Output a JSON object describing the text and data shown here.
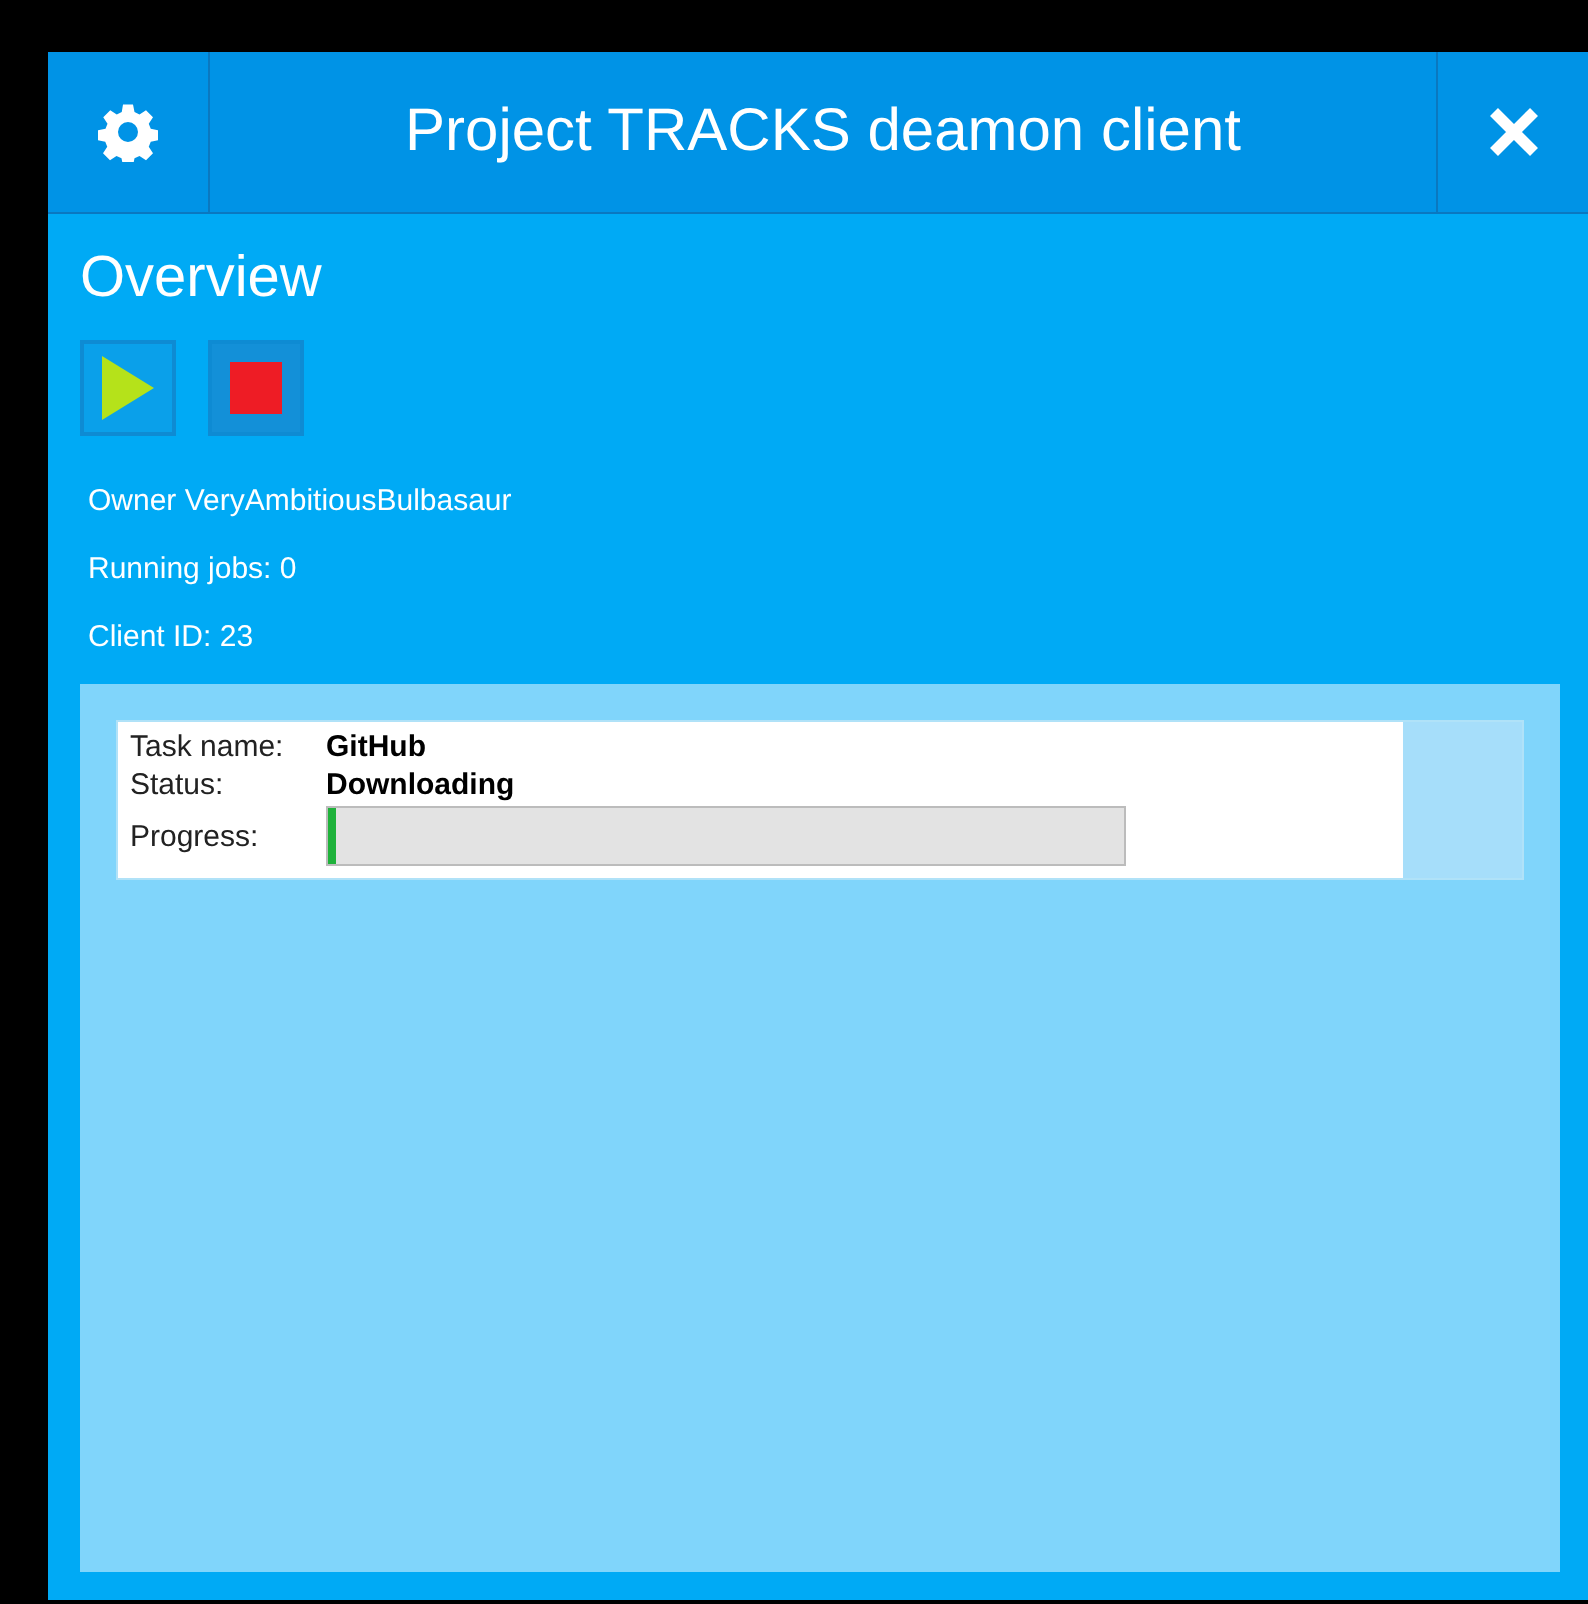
{
  "window": {
    "title": "Project TRACKS deamon client"
  },
  "section_title": "Overview",
  "info": [
    "Owner VeryAmbitiousBulbasaur",
    "Running jobs: 0",
    "Client ID: 23"
  ],
  "tasks": [
    {
      "name_label": "Task name:",
      "name": "GitHub",
      "status_label": "Status:",
      "status": "Downloading",
      "progress_label": "Progress:",
      "level": 0.01
    }
  ]
}
